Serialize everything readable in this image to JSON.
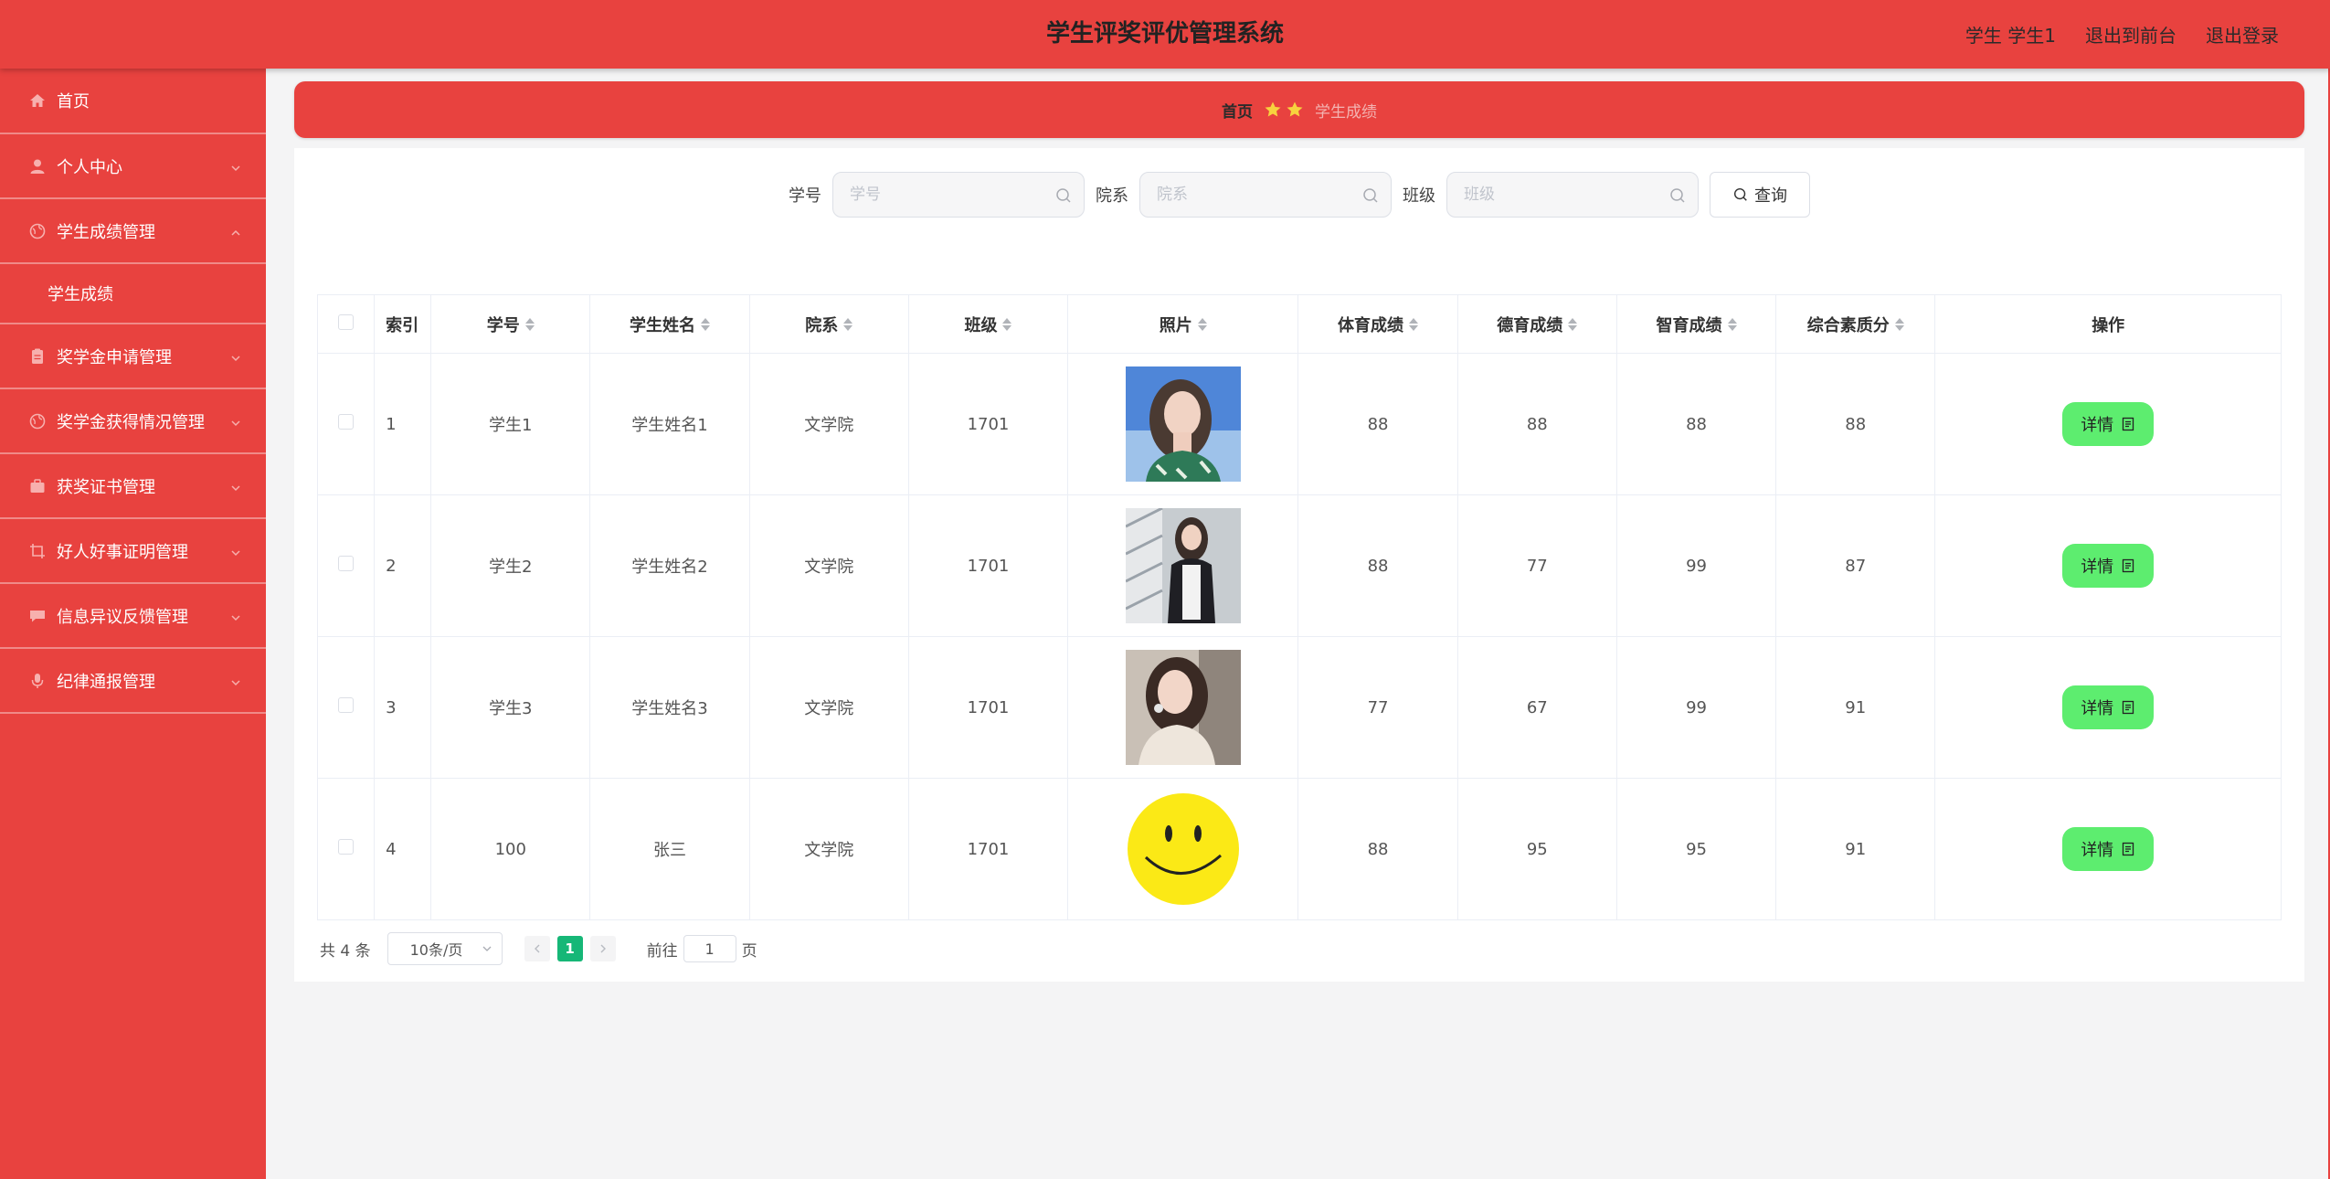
{
  "header": {
    "title": "学生评奖评优管理系统",
    "user": "学生 学生1",
    "to_front": "退出到前台",
    "logout": "退出登录"
  },
  "sidebar": {
    "items": [
      {
        "label": "首页",
        "icon": "home-icon"
      },
      {
        "label": "个人中心",
        "icon": "user-icon"
      },
      {
        "label": "学生成绩管理",
        "icon": "globe-icon",
        "expanded": true
      },
      {
        "label": "学生成绩",
        "icon": ""
      },
      {
        "label": "奖学金申请管理",
        "icon": "clipboard-icon"
      },
      {
        "label": "奖学金获得情况管理",
        "icon": "globe-icon"
      },
      {
        "label": "获奖证书管理",
        "icon": "briefcase-icon"
      },
      {
        "label": "好人好事证明管理",
        "icon": "crop-icon"
      },
      {
        "label": "信息异议反馈管理",
        "icon": "message-icon"
      },
      {
        "label": "纪律通报管理",
        "icon": "mic-icon"
      }
    ]
  },
  "breadcrumb": {
    "home": "首页",
    "current": "学生成绩"
  },
  "search": {
    "fields": [
      {
        "label": "学号",
        "placeholder": "学号"
      },
      {
        "label": "院系",
        "placeholder": "院系"
      },
      {
        "label": "班级",
        "placeholder": "班级"
      }
    ],
    "button": "查询"
  },
  "table": {
    "columns": [
      "索引",
      "学号",
      "学生姓名",
      "院系",
      "班级",
      "照片",
      "体育成绩",
      "德育成绩",
      "智育成绩",
      "综合素质分",
      "操作"
    ],
    "rows": [
      {
        "index": "1",
        "id": "学生1",
        "name": "学生姓名1",
        "dept": "文学院",
        "class": "1701",
        "pe": "88",
        "moral": "88",
        "intel": "88",
        "overall": "88",
        "action": "详情"
      },
      {
        "index": "2",
        "id": "学生2",
        "name": "学生姓名2",
        "dept": "文学院",
        "class": "1701",
        "pe": "88",
        "moral": "77",
        "intel": "99",
        "overall": "87",
        "action": "详情"
      },
      {
        "index": "3",
        "id": "学生3",
        "name": "学生姓名3",
        "dept": "文学院",
        "class": "1701",
        "pe": "77",
        "moral": "67",
        "intel": "99",
        "overall": "91",
        "action": "详情"
      },
      {
        "index": "4",
        "id": "100",
        "name": "张三",
        "dept": "文学院",
        "class": "1701",
        "pe": "88",
        "moral": "95",
        "intel": "95",
        "overall": "91",
        "action": "详情"
      }
    ]
  },
  "pager": {
    "total": "共 4 条",
    "page_size": "10条/页",
    "current_page": "1",
    "goto_prefix": "前往",
    "goto_value": "1",
    "goto_suffix": "页"
  },
  "colors": {
    "primary": "#e8423f",
    "detail_button": "#5ded6f",
    "page_active": "#16b777"
  }
}
